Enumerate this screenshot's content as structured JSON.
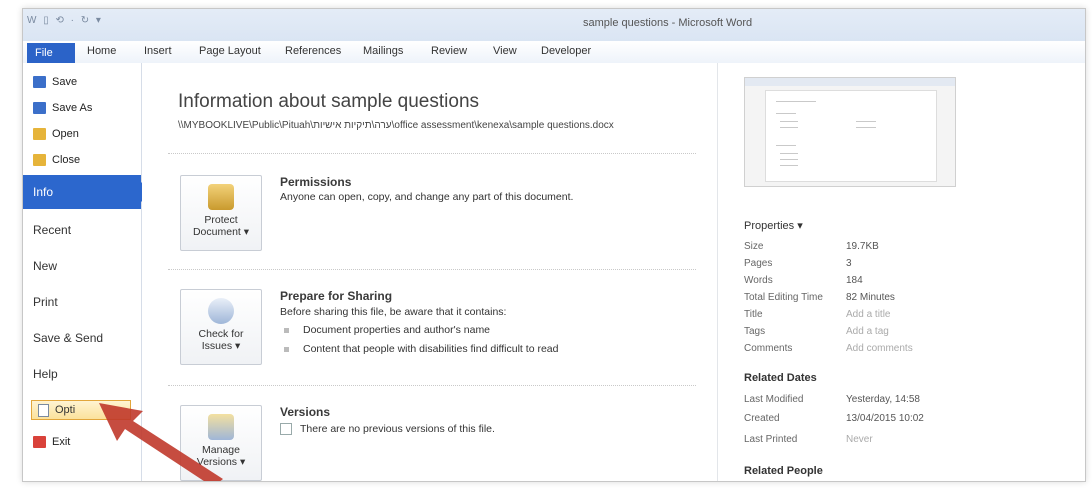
{
  "window": {
    "title": "sample questions - Microsoft Word",
    "qat": "W  ▯  ⟲ · ↻ ▾"
  },
  "ribbon": {
    "tabs": [
      "File",
      "Home",
      "Insert",
      "Page Layout",
      "References",
      "Mailings",
      "Review",
      "View",
      "Developer"
    ]
  },
  "backstage": {
    "commands": [
      {
        "label": "Save",
        "icon": "save-icon",
        "color": "#3b6fc9"
      },
      {
        "label": "Save As",
        "icon": "save-as-icon",
        "color": "#3b6fc9"
      },
      {
        "label": "Open",
        "icon": "folder-open-icon",
        "color": "#e6b43a"
      },
      {
        "label": "Close",
        "icon": "folder-close-icon",
        "color": "#e6b43a"
      }
    ],
    "nav": [
      {
        "label": "Info",
        "active": true
      },
      {
        "label": "Recent"
      },
      {
        "label": "New"
      },
      {
        "label": "Print"
      },
      {
        "label": "Save & Send"
      },
      {
        "label": "Help"
      }
    ],
    "options_label": "Opti",
    "exit_label": "Exit"
  },
  "info": {
    "title": "Information about sample questions",
    "path": "\\\\MYBOOKLIVE\\Public\\Pituah\\ערה\\תיקיות אישיות\\office assessment\\kenexa\\sample questions.docx",
    "permissions": {
      "button": [
        "Protect",
        "Document ▾"
      ],
      "heading": "Permissions",
      "text": "Anyone can open, copy, and change any part of this document."
    },
    "sharing": {
      "button": [
        "Check for",
        "Issues ▾"
      ],
      "heading": "Prepare for Sharing",
      "text": "Before sharing this file, be aware that it contains:",
      "bullets": [
        "Document properties and author's name",
        "Content that people with disabilities find difficult to read"
      ]
    },
    "versions": {
      "button": [
        "Manage",
        "Versions ▾"
      ],
      "heading": "Versions",
      "text": "There are no previous versions of this file."
    }
  },
  "properties": {
    "heading": "Properties ▾",
    "rows": [
      {
        "k": "Size",
        "v": "19.7KB"
      },
      {
        "k": "Pages",
        "v": "3"
      },
      {
        "k": "Words",
        "v": "184"
      },
      {
        "k": "Total Editing Time",
        "v": "82 Minutes"
      },
      {
        "k": "Title",
        "v": "Add a title",
        "placeholder": true
      },
      {
        "k": "Tags",
        "v": "Add a tag",
        "placeholder": true
      },
      {
        "k": "Comments",
        "v": "Add comments",
        "placeholder": true
      }
    ],
    "related_dates_heading": "Related Dates",
    "dates": [
      {
        "k": "Last Modified",
        "v": "Yesterday, 14:58"
      },
      {
        "k": "Created",
        "v": "13/04/2015 10:02"
      },
      {
        "k": "Last Printed",
        "v": "Never",
        "placeholder": true
      }
    ],
    "related_people_heading": "Related People"
  }
}
